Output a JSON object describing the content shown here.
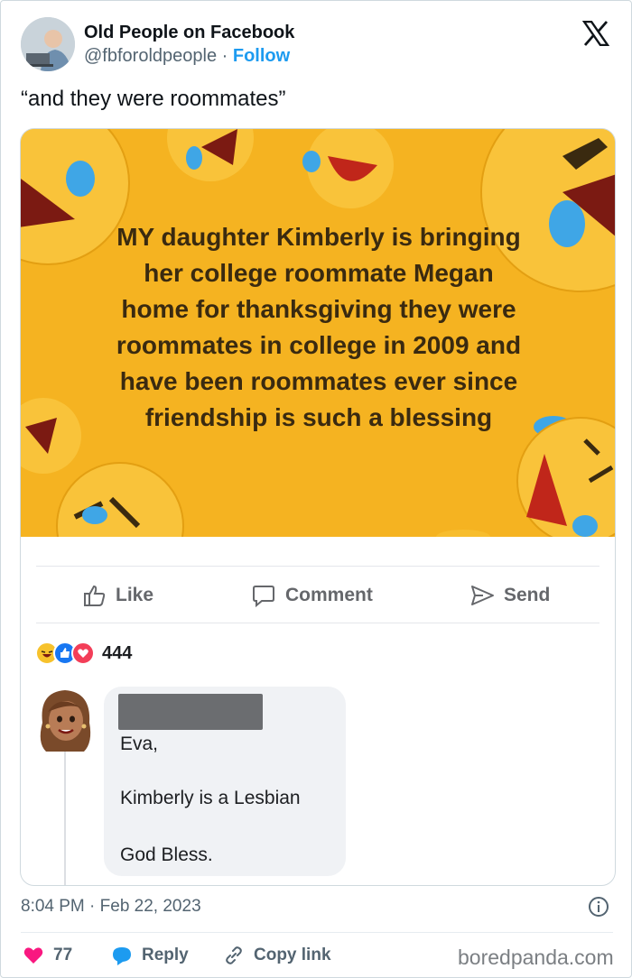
{
  "header": {
    "display_name": "Old People on Facebook",
    "handle": "@fbforoldpeople",
    "separator": "·",
    "follow_label": "Follow"
  },
  "tweet": {
    "text": "“and they were roommates”"
  },
  "meme": {
    "lines": [
      "MY daughter Kimberly is bringing",
      "her college roommate Megan",
      "home for thanksgiving they were",
      "roommates in college in 2009 and",
      "have been roommates ever since",
      "friendship is such a blessing"
    ],
    "background_color": "#f5b321"
  },
  "fb_actions": {
    "like": "Like",
    "comment": "Comment",
    "send": "Send"
  },
  "reactions": {
    "count": "444",
    "icons": [
      "haha-icon",
      "like-icon",
      "love-icon"
    ]
  },
  "comment": {
    "greeting": "Eva,",
    "body": "Kimberly is a Lesbian",
    "closing": "God Bless."
  },
  "meta": {
    "time": "8:04 PM",
    "separator": "·",
    "date": "Feb 22, 2023"
  },
  "engagement": {
    "likes": "77",
    "reply_label": "Reply",
    "copy_label": "Copy link"
  },
  "watermark": "boredpanda.com",
  "colors": {
    "accent": "#1d9bf0",
    "heart": "#f91880",
    "text_secondary": "#536471"
  }
}
